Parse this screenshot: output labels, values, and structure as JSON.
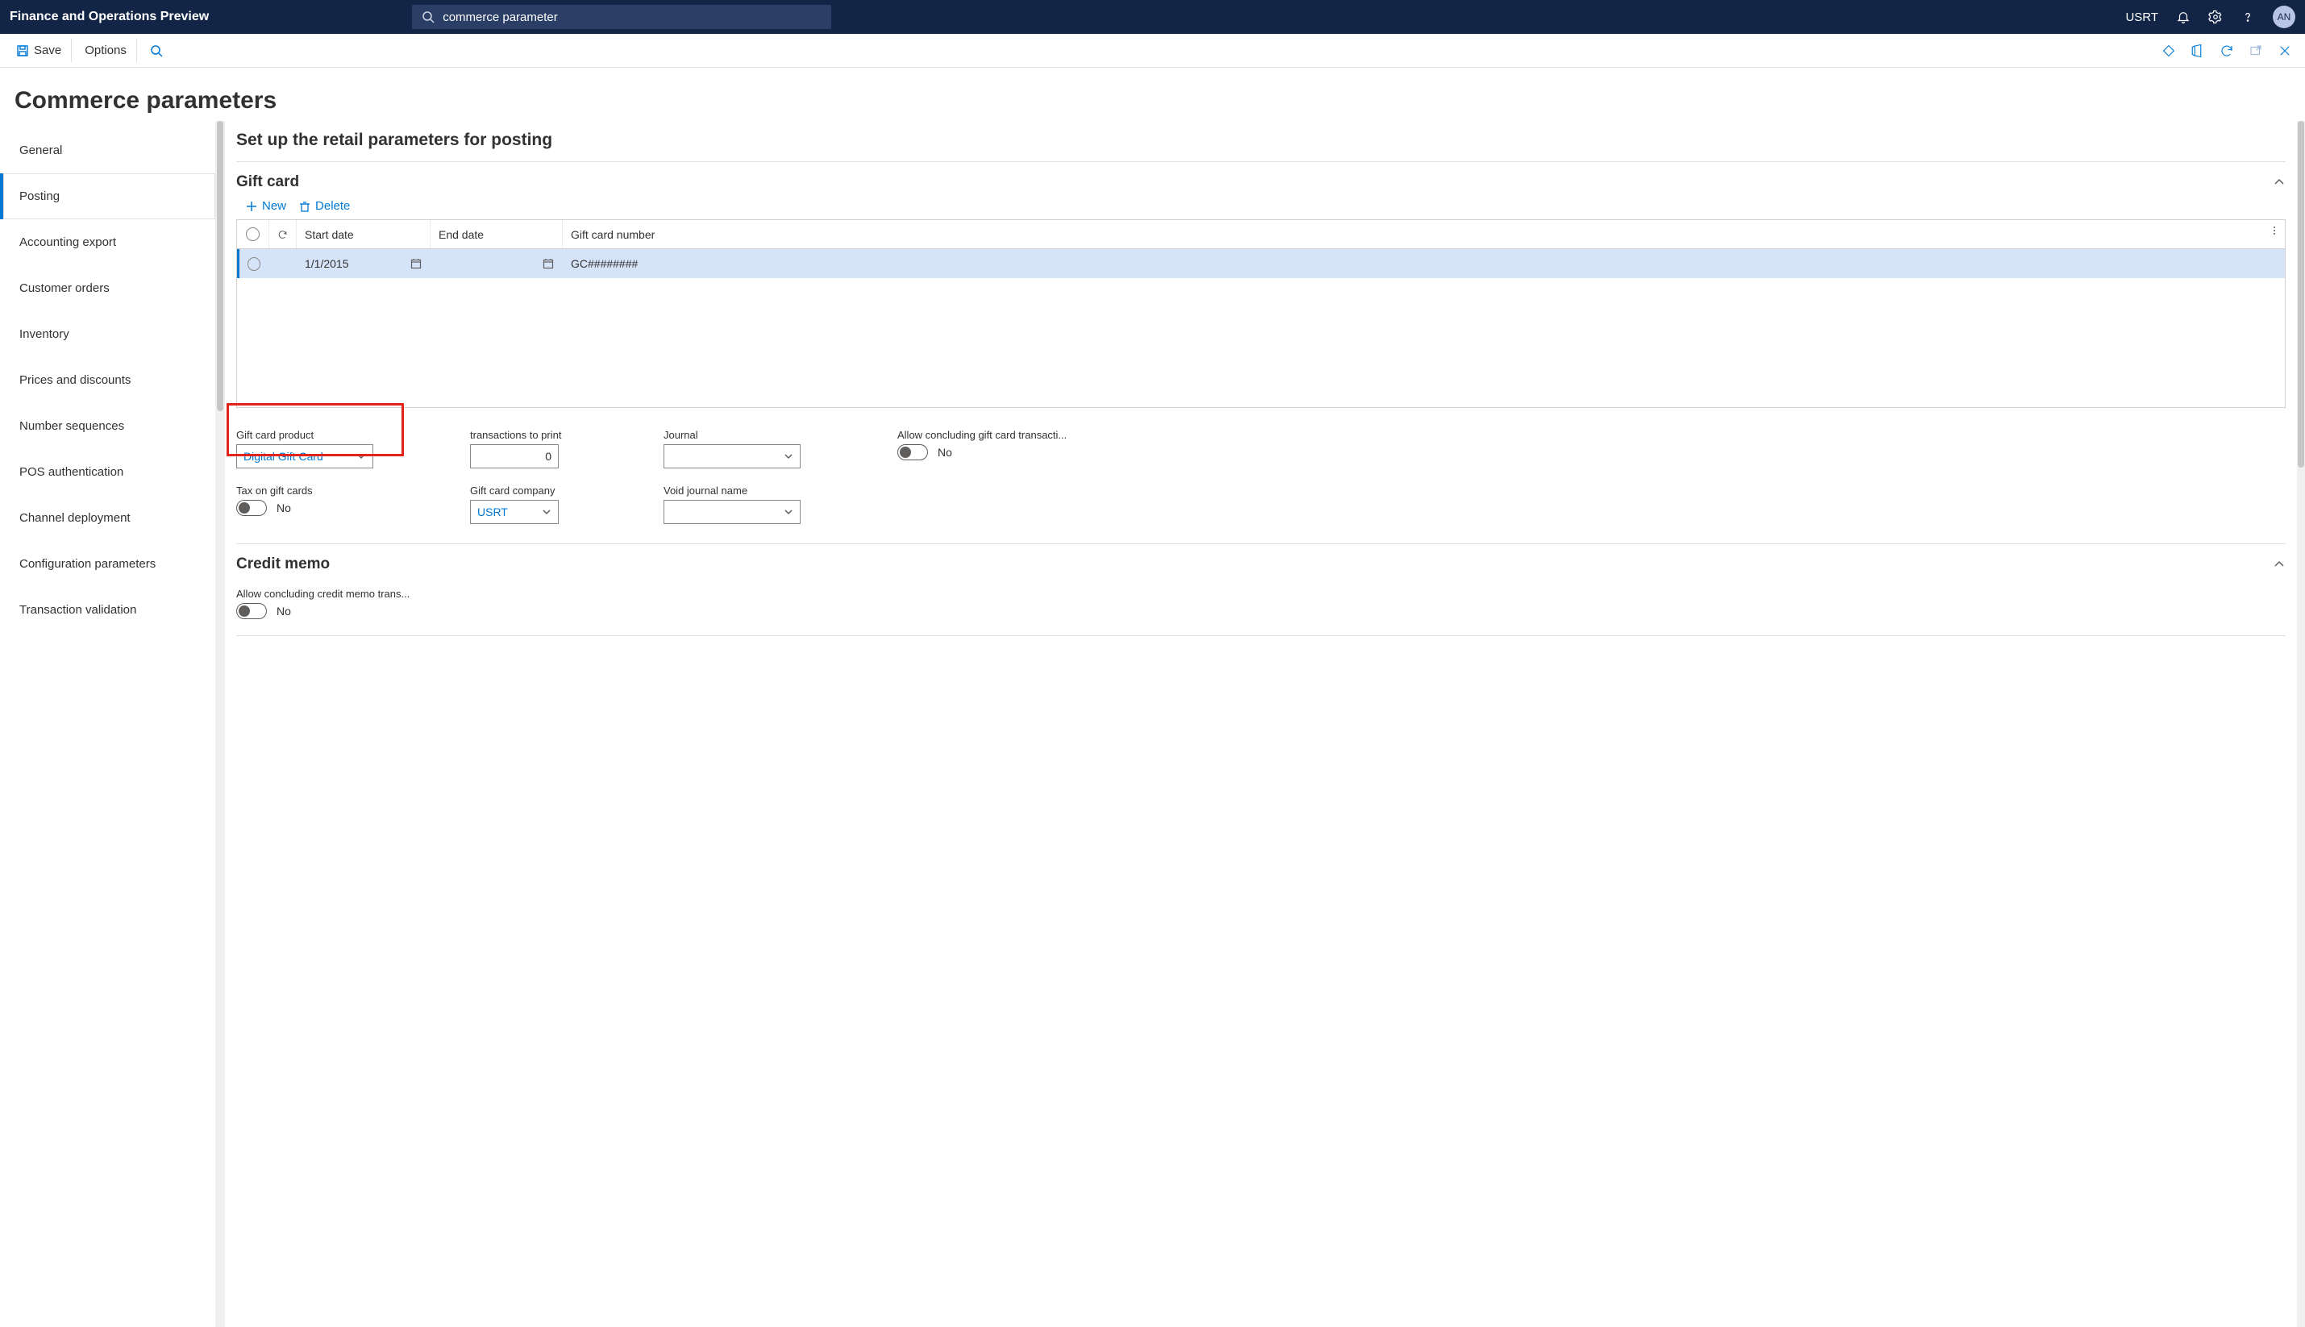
{
  "topbar": {
    "brand": "Finance and Operations Preview",
    "search_value": "commerce parameter",
    "company": "USRT",
    "avatar": "AN"
  },
  "cmdbar": {
    "save": "Save",
    "options": "Options"
  },
  "page": {
    "title": "Commerce parameters",
    "section_title": "Set up the retail parameters for posting"
  },
  "sidenav": [
    "General",
    "Posting",
    "Accounting export",
    "Customer orders",
    "Inventory",
    "Prices and discounts",
    "Number sequences",
    "POS authentication",
    "Channel deployment",
    "Configuration parameters",
    "Transaction validation"
  ],
  "active_nav_index": 1,
  "gift_card_section": {
    "heading": "Gift card",
    "new_label": "New",
    "delete_label": "Delete",
    "columns": {
      "start": "Start date",
      "end": "End date",
      "gcn": "Gift card number"
    },
    "row": {
      "start": "1/1/2015",
      "end": "",
      "gcn": "GC########"
    }
  },
  "fields": {
    "gcp_label": "Gift card product",
    "gcp_value": "Digital Gift Card",
    "tax_label": "Tax on gift cards",
    "tax_value": "No",
    "ttp_label": "transactions to print",
    "ttp_value": "0",
    "gcc_label": "Gift card company",
    "gcc_value": "USRT",
    "journal_label": "Journal",
    "journal_value": "",
    "void_label": "Void journal name",
    "void_value": "",
    "allow_label": "Allow concluding gift card transacti...",
    "allow_value": "No"
  },
  "credit_memo": {
    "heading": "Credit memo",
    "allow_label": "Allow concluding credit memo trans...",
    "allow_value": "No"
  }
}
